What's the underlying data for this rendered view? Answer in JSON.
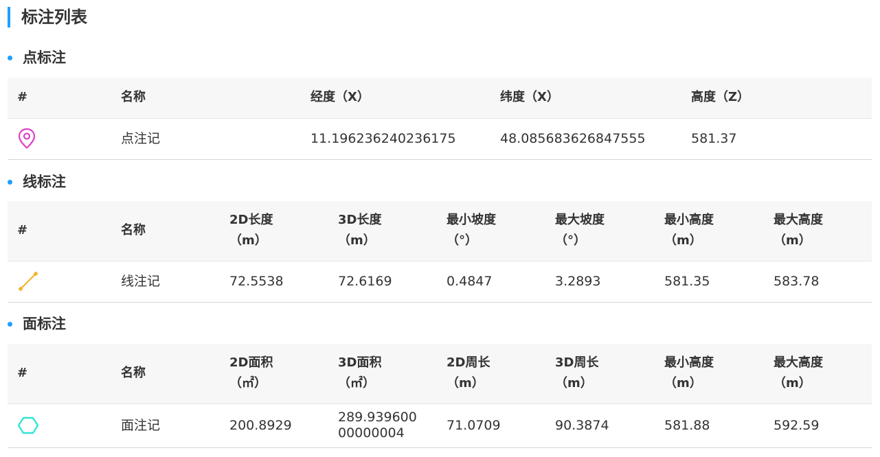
{
  "page": {
    "title": "标注列表"
  },
  "point_section": {
    "title": "点标注",
    "headers": [
      "#",
      "名称",
      "经度（X）",
      "纬度（X）",
      "高度（Z）"
    ],
    "rows": [
      {
        "icon": "map-pin-icon",
        "name": "点注记",
        "lon": "11.196236240236175",
        "lat": "48.085683626847555",
        "height": "581.37"
      }
    ]
  },
  "line_section": {
    "title": "线标注",
    "headers": [
      {
        "label": "#",
        "unit": ""
      },
      {
        "label": "名称",
        "unit": ""
      },
      {
        "label": "2D长度",
        "unit": "（m）"
      },
      {
        "label": "3D长度",
        "unit": "（m）"
      },
      {
        "label": "最小坡度",
        "unit": "（°）"
      },
      {
        "label": "最大坡度",
        "unit": "（°）"
      },
      {
        "label": "最小高度",
        "unit": "（m）"
      },
      {
        "label": "最大高度",
        "unit": "（m）"
      }
    ],
    "rows": [
      {
        "icon": "line-segment-icon",
        "name": "线注记",
        "len2d": "72.5538",
        "len3d": "72.6169",
        "min_slope": "0.4847",
        "max_slope": "3.2893",
        "min_h": "581.35",
        "max_h": "583.78"
      }
    ]
  },
  "area_section": {
    "title": "面标注",
    "headers": [
      {
        "label": "#",
        "unit": ""
      },
      {
        "label": "名称",
        "unit": ""
      },
      {
        "label": "2D面积",
        "unit": "（㎡）"
      },
      {
        "label": "3D面积",
        "unit": "（㎡）"
      },
      {
        "label": "2D周长",
        "unit": "（m）"
      },
      {
        "label": "3D周长",
        "unit": "（m）"
      },
      {
        "label": "最小高度",
        "unit": "（m）"
      },
      {
        "label": "最大高度",
        "unit": "（m）"
      }
    ],
    "rows": [
      {
        "icon": "hexagon-icon",
        "name": "面注记",
        "area2d": "200.8929",
        "area3d_line1": "289.939600",
        "area3d_line2": "00000004",
        "perim2d": "71.0709",
        "perim3d": "90.3874",
        "min_h": "581.88",
        "max_h": "592.59"
      }
    ]
  },
  "colors": {
    "accent": "#1e9fff",
    "point_icon": "#e040c8",
    "line_icon": "#f0b429",
    "area_icon": "#2ee6d6"
  }
}
